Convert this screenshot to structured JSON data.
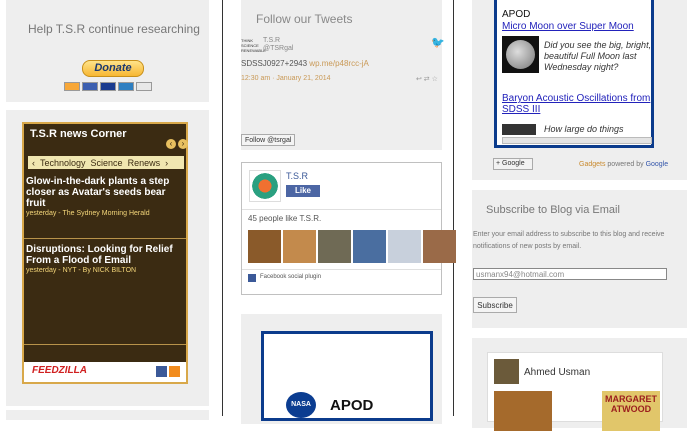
{
  "left": {
    "help_title": "Help T.S.R continue researching",
    "donate_label": "Donate",
    "news": {
      "title": "T.S.R news Corner",
      "prev": "‹",
      "next": "›",
      "tabs": [
        "Technology",
        "Science",
        "Renews"
      ],
      "tab_arrow_left": "‹",
      "tab_arrow_right": "›",
      "items": [
        {
          "title": "Glow-in-the-dark plants a step closer as Avatar's seeds bear fruit",
          "meta": "yesterday - The Sydney Morning Herald"
        },
        {
          "title": "Disruptions: Looking for Relief From a Flood of Email",
          "meta": "yesterday - NYT - By NICK BILTON"
        }
      ],
      "footer_brand": "FEEDZILLA"
    }
  },
  "middle": {
    "tweets_title": "Follow our Tweets",
    "tweet": {
      "logo_text": "THINK SCIENCE RENEWABLE",
      "name": "T.S.R",
      "handle": "@TSRgal",
      "text": "SDSSJ0927+2943",
      "link": "wp.me/p48rcc-jA",
      "date": "12:30 am · January 21, 2014",
      "actions": "↩ ⇄ ☆"
    },
    "follow_label": "Follow @tsrgal",
    "facebook": {
      "name": "T.S.R",
      "like_label": "Like",
      "count_text": "45 people like T.S.R.",
      "plugin_label": "Facebook social plugin"
    },
    "apod": {
      "nasa_label": "NASA",
      "title": "APOD"
    }
  },
  "right": {
    "apod": {
      "heading": "APOD",
      "link1": "Micro Moon over Super Moon",
      "desc": "Did you see the big, bright, beautiful Full Moon last Wednesday night?",
      "link2": "Baryon Acoustic Oscillations from SDSS III",
      "link3": "How large do things"
    },
    "gadgets": {
      "badge": "+ Google",
      "text_orange": "Gadgets",
      "text_plain": " powered by ",
      "text_blue": "Google"
    },
    "subscribe": {
      "title": "Subscribe to Blog via Email",
      "desc": "Enter your email address to subscribe to this blog and receive notifications of new posts by email.",
      "email_value": "usmanx94@hotmail.com",
      "button": "Subscribe"
    },
    "profile": {
      "name": "Ahmed Usman",
      "book_text": "MARGARET ATWOOD"
    }
  }
}
